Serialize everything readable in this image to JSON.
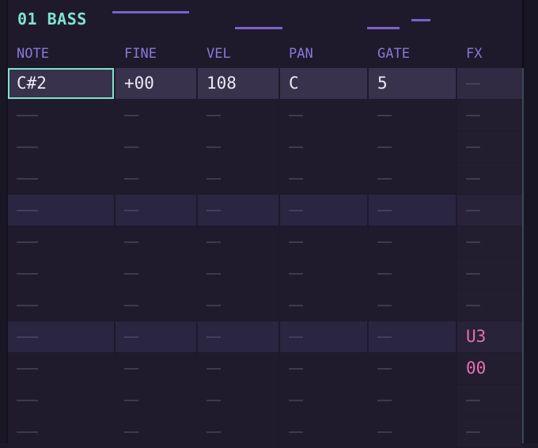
{
  "track": {
    "title": "01 BASS"
  },
  "columns": [
    "NOTE",
    "FINE",
    "VEL",
    "PAN",
    "GATE",
    "FX"
  ],
  "empty_note": "———",
  "empty_short": "——",
  "rows": [
    [
      "C#2",
      "+00",
      "108",
      "C",
      "5",
      "——"
    ],
    [
      "———",
      "——",
      "——",
      "——",
      "——",
      "——"
    ],
    [
      "———",
      "——",
      "——",
      "——",
      "——",
      "——"
    ],
    [
      "———",
      "——",
      "——",
      "——",
      "——",
      "——"
    ],
    [
      "———",
      "——",
      "——",
      "——",
      "——",
      "——"
    ],
    [
      "———",
      "——",
      "——",
      "——",
      "——",
      "——"
    ],
    [
      "———",
      "——",
      "——",
      "——",
      "——",
      "——"
    ],
    [
      "———",
      "——",
      "——",
      "——",
      "——",
      "——"
    ],
    [
      "———",
      "——",
      "——",
      "——",
      "——",
      "U3"
    ],
    [
      "———",
      "——",
      "——",
      "——",
      "——",
      "00"
    ],
    [
      "———",
      "——",
      "——",
      "——",
      "——",
      "——"
    ],
    [
      "———",
      "——",
      "——",
      "——",
      "——",
      "——"
    ]
  ],
  "colors": {
    "accent_teal": "#7fe3cf",
    "header_purple": "#8a78d6",
    "fx_pink": "#e96fb0",
    "meter_purple": "#7a62c8"
  }
}
